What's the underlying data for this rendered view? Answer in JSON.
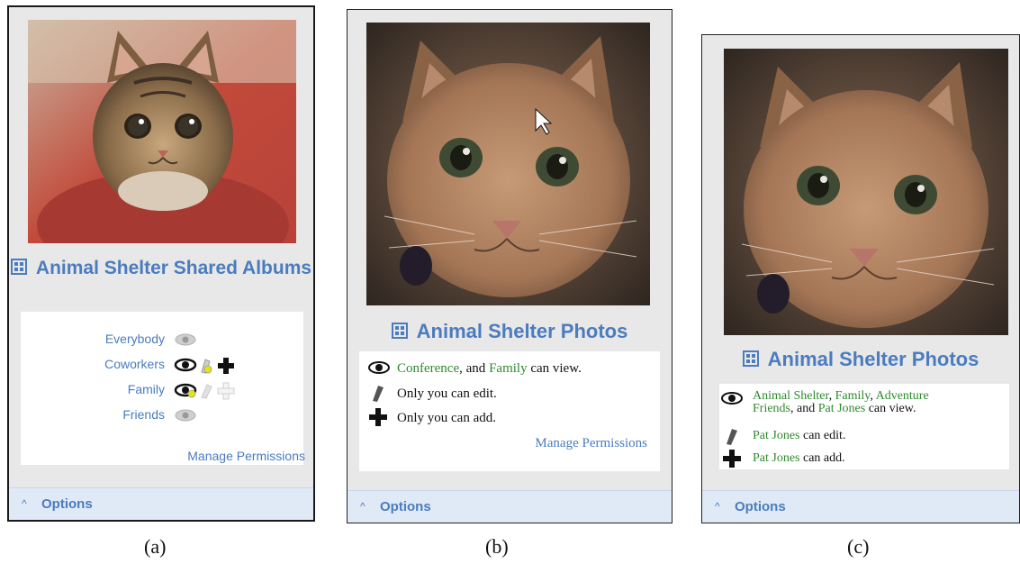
{
  "panels": {
    "a": {
      "title": "Animal Shelter Shared Albums",
      "groups": [
        {
          "name": "Everybody",
          "view": "shared-grey",
          "edit": "none",
          "add": "none"
        },
        {
          "name": "Coworkers",
          "view": "black",
          "edit": "pencil-new",
          "add": "black"
        },
        {
          "name": "Family",
          "view": "black-new",
          "edit": "grey",
          "add": "grey"
        },
        {
          "name": "Friends",
          "view": "shared-grey",
          "edit": "none",
          "add": "none"
        }
      ],
      "manage_link": "Manage Permissions",
      "options_label": "Options",
      "caption": "(a)"
    },
    "b": {
      "title": "Animal Shelter Photos",
      "view_line": {
        "g1": "Conference",
        "t1": ", and ",
        "g2": "Family",
        "t2": " can view."
      },
      "edit_line": "Only you can edit.",
      "add_line": "Only you can add.",
      "manage_link": "Manage Permissions",
      "options_label": "Options",
      "caption": "(b)"
    },
    "c": {
      "title": "Animal Shelter Photos",
      "view_line": {
        "g1": "Animal Shelter",
        "t1": ", ",
        "g2": "Family",
        "t2": ", ",
        "g3": "Adventure",
        "g4": "Friends",
        "t3": ", and ",
        "g5": "Pat Jones",
        "t4": " can view."
      },
      "edit_line": {
        "g1": "Pat Jones",
        "t1": " can edit."
      },
      "add_line": {
        "g1": "Pat Jones",
        "t1": " can add."
      },
      "options_label": "Options",
      "caption": "(c)"
    }
  },
  "icons": {
    "album": "photo-album-icon",
    "view": "eye-icon",
    "edit": "pencil-icon",
    "add": "plus-icon",
    "options": "chevron-up-icon"
  },
  "colors": {
    "link_blue": "#4a7cbf",
    "group_green": "#2e8b2e",
    "panel_grey": "#e8e8e8",
    "options_bar": "#dfeaf6",
    "new_highlight": "#e6e600"
  }
}
